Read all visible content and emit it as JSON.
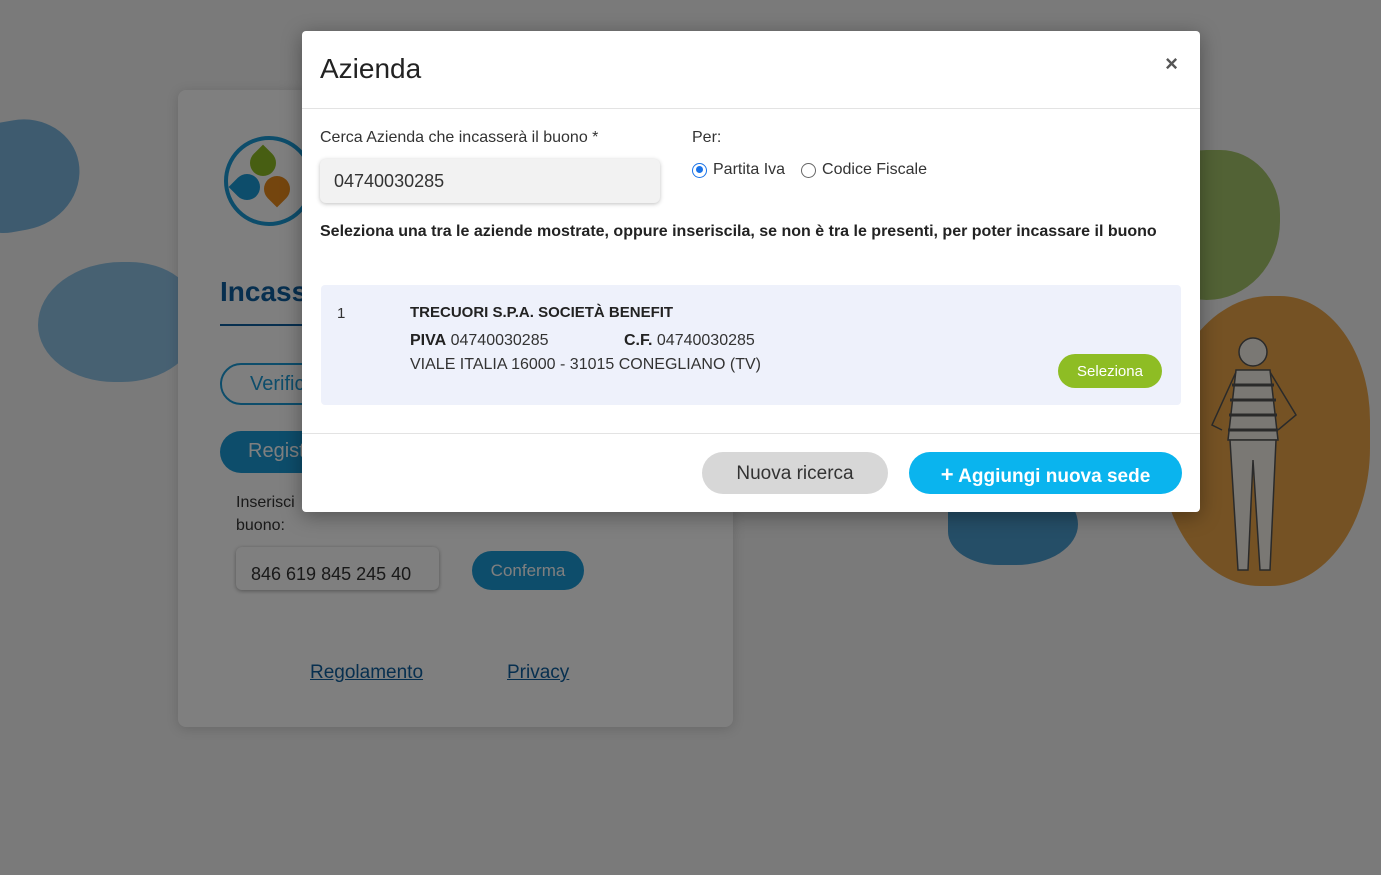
{
  "background": {
    "card_title": "Incass",
    "verify_button_label": "Verific",
    "register_button_label": "Regist",
    "code_label": "Inserisci\nbuono:",
    "code_value": "846 619 845 245 40",
    "confirm_label": "Conferma",
    "links": {
      "regolamento": "Regolamento",
      "privacy": "Privacy"
    }
  },
  "modal": {
    "title": "Azienda",
    "close_symbol": "×",
    "search": {
      "label": "Cerca Azienda che incasserà il buono *",
      "value": "04740030285"
    },
    "per": {
      "label": "Per:",
      "options": [
        {
          "label": "Partita Iva",
          "checked": true
        },
        {
          "label": "Codice Fiscale",
          "checked": false
        }
      ]
    },
    "instruction": "Seleziona una tra le aziende mostrate, oppure inseriscila, se non è tra le presenti, per poter incassare il buono",
    "results": [
      {
        "index": "1",
        "name": "TRECUORI S.P.A. SOCIETÀ BENEFIT",
        "piva_label": "PIVA",
        "piva": "04740030285",
        "cf_label": "C.F.",
        "cf": "04740030285",
        "address": "VIALE ITALIA 16000 - 31015 CONEGLIANO (TV)",
        "select_label": "Seleziona"
      }
    ],
    "footer": {
      "new_search_label": "Nuova ricerca",
      "add_label": "Aggiungi nuova sede",
      "add_icon": "+"
    }
  },
  "colors": {
    "primary_blue": "#1b9ad6",
    "add_button": "#0ab4ee",
    "select_button": "#8ebd24",
    "result_background": "#eef1fb"
  }
}
